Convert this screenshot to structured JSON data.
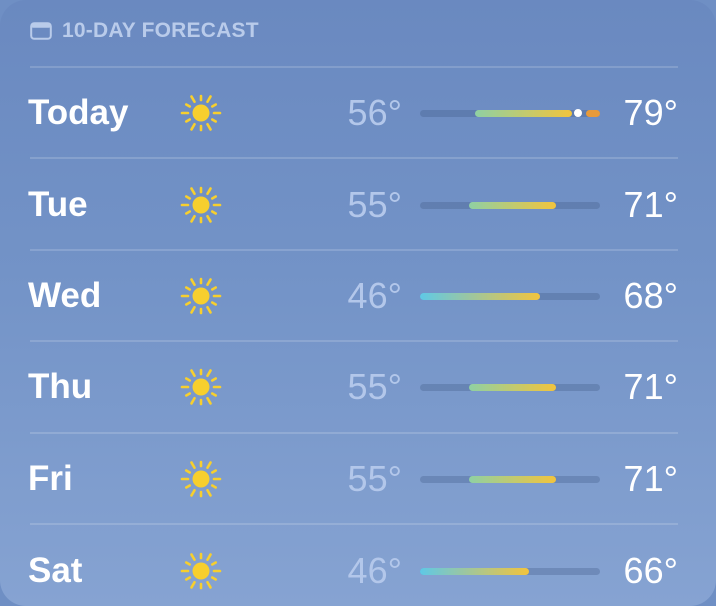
{
  "header": {
    "icon": "calendar-icon",
    "label": "10-DAY FORECAST"
  },
  "colors": {
    "background": "#6f8fc4",
    "header_text": "#b9cbea",
    "low_text": "#b3c7ea",
    "high_text": "#ffffff",
    "sun": "#f7cf2e",
    "bar_cool": "#5fc8e6",
    "bar_mild": "#8fd0a3",
    "bar_warm": "#f2c43d",
    "bar_hot": "#e79a3a"
  },
  "range": {
    "min": 46,
    "max": 79
  },
  "days": [
    {
      "day": "Today",
      "icon": "sun-icon",
      "low": "56°",
      "high": "79°",
      "low_value": 56,
      "high_value": 79,
      "current_value": 75
    },
    {
      "day": "Tue",
      "icon": "sun-icon",
      "low": "55°",
      "high": "71°",
      "low_value": 55,
      "high_value": 71
    },
    {
      "day": "Wed",
      "icon": "sun-icon",
      "low": "46°",
      "high": "68°",
      "low_value": 46,
      "high_value": 68
    },
    {
      "day": "Thu",
      "icon": "sun-icon",
      "low": "55°",
      "high": "71°",
      "low_value": 55,
      "high_value": 71
    },
    {
      "day": "Fri",
      "icon": "sun-icon",
      "low": "55°",
      "high": "71°",
      "low_value": 55,
      "high_value": 71
    },
    {
      "day": "Sat",
      "icon": "sun-icon",
      "low": "46°",
      "high": "66°",
      "low_value": 46,
      "high_value": 66
    }
  ]
}
